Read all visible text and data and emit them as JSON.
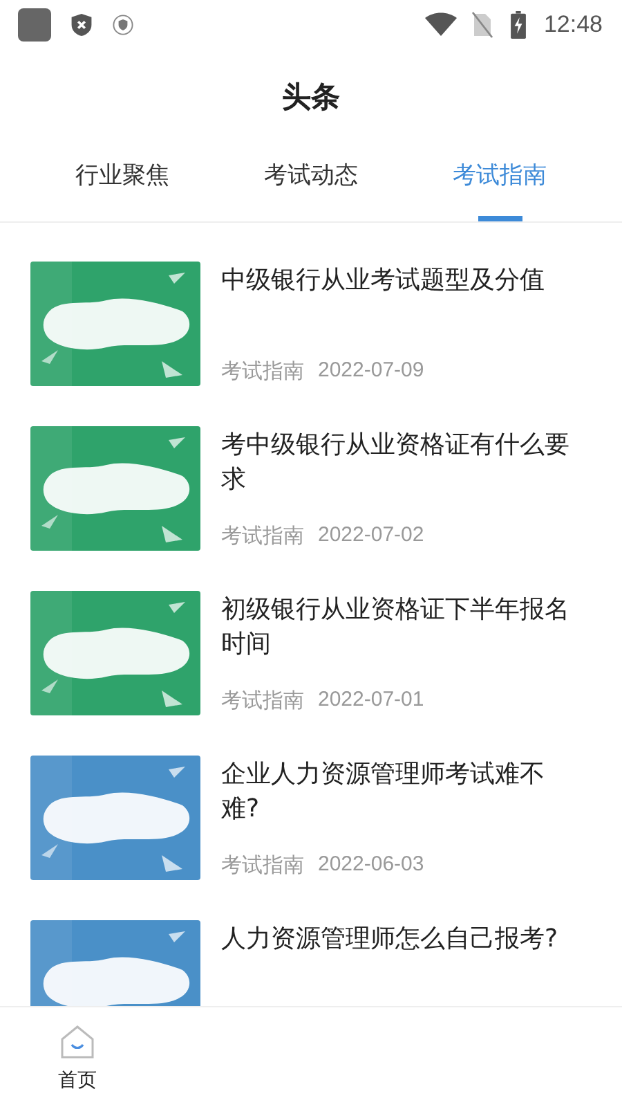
{
  "status_bar": {
    "time": "12:48"
  },
  "header": {
    "title": "头条"
  },
  "tabs": [
    {
      "label": "行业聚焦",
      "selected": false
    },
    {
      "label": "考试动态",
      "selected": false
    },
    {
      "label": "考试指南",
      "selected": true
    }
  ],
  "articles": [
    {
      "title": "中级银行从业考试题型及分值",
      "category": "考试指南",
      "date": "2022-07-09"
    },
    {
      "title": "考中级银行从业资格证有什么要求",
      "category": "考试指南",
      "date": "2022-07-02"
    },
    {
      "title": "初级银行从业资格证下半年报名时间",
      "category": "考试指南",
      "date": "2022-07-01"
    },
    {
      "title": "企业人力资源管理师考试难不难?",
      "category": "考试指南",
      "date": "2022-06-03"
    },
    {
      "title": "人力资源管理师怎么自己报考?"
    }
  ],
  "bottom_nav": [
    {
      "label": "首页",
      "selected": true
    }
  ]
}
